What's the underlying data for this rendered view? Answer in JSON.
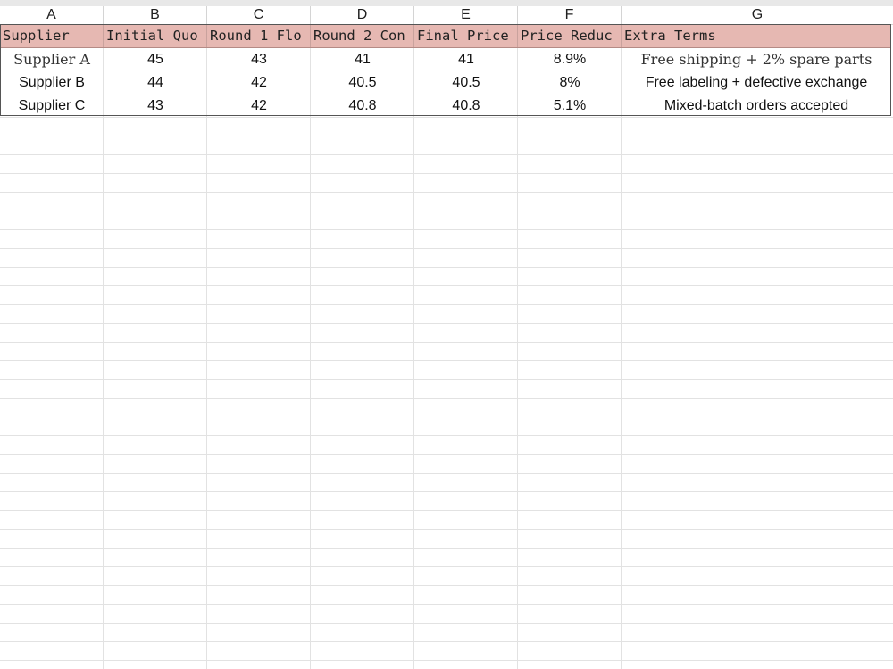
{
  "columns": [
    "A",
    "B",
    "C",
    "D",
    "E",
    "F",
    "G"
  ],
  "headers": [
    "Supplier",
    "Initial Quo",
    "Round 1 Flo",
    "Round 2 Con",
    "Final Price",
    "Price Reduc",
    "Extra Terms"
  ],
  "rows": [
    [
      "Supplier A",
      "45",
      "43",
      "41",
      "41",
      "8.9%",
      "Free shipping + 2% spare parts"
    ],
    [
      "Supplier B",
      "44",
      "42",
      "40.5",
      "40.5",
      "8%",
      "Free labeling + defective exchange"
    ],
    [
      "Supplier C",
      "43",
      "42",
      "40.8",
      "40.8",
      "5.1%",
      "Mixed-batch orders accepted"
    ]
  ]
}
